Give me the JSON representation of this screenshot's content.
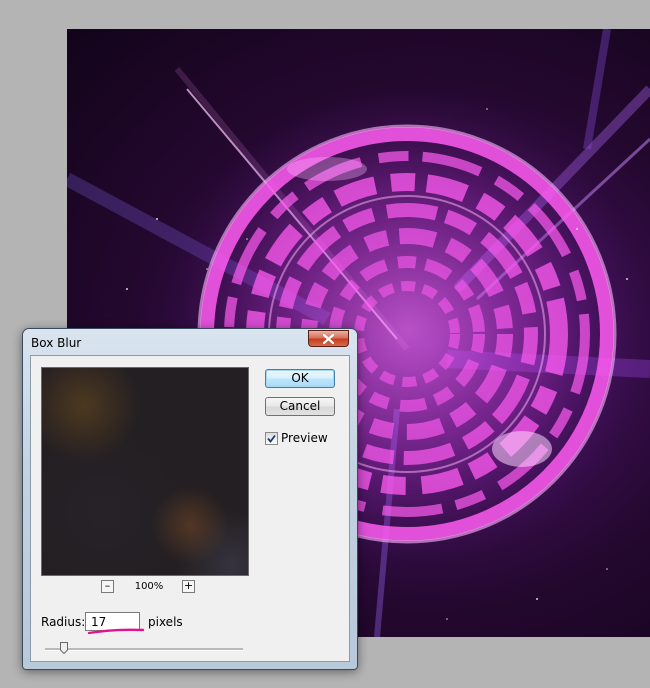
{
  "canvas": {
    "description_icon": "artwork-image"
  },
  "dialog": {
    "title": "Box Blur",
    "close_icon": "close-icon",
    "ok_label": "OK",
    "cancel_label": "Cancel",
    "preview_label": "Preview",
    "preview_checked": true,
    "zoom_out_label": "–",
    "zoom_in_label": "+",
    "zoom_level": "100%",
    "radius_label": "Radius:",
    "radius_value": "17",
    "radius_units": "pixels",
    "slider_fraction": 0.08
  },
  "colors": {
    "accent_underline": "#e0148c",
    "close_red": "#c23f23",
    "artwork_magenta": "#e04ee8"
  }
}
